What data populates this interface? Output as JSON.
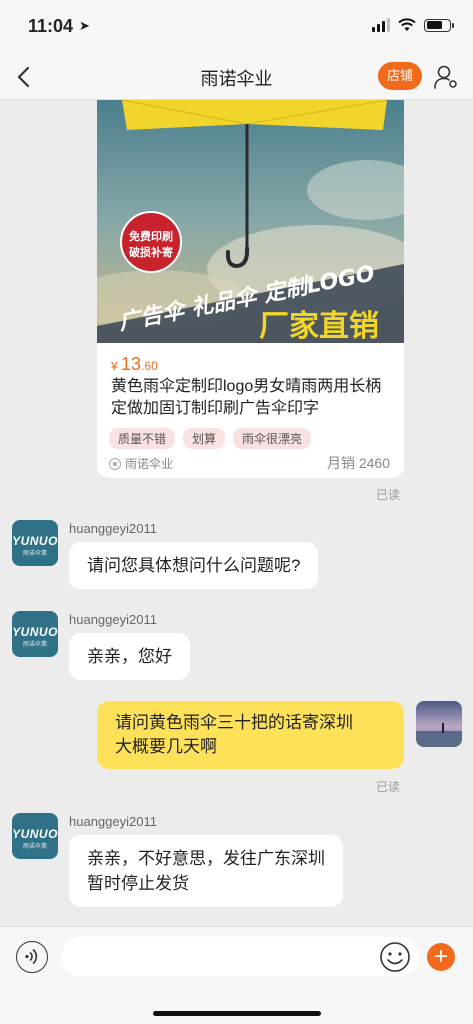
{
  "status_bar": {
    "time": "11:04"
  },
  "nav": {
    "title": "雨诺伞业",
    "shop_button": "店铺"
  },
  "product": {
    "image_text": {
      "badge_line1": "免费印刷",
      "badge_line2": "破损补寄",
      "slogan": "广告伞 礼品伞 定制LOGO",
      "headline": "厂家直销"
    },
    "price_symbol": "¥",
    "price_main": "13",
    "price_decimal": ".60",
    "title": "黄色雨伞定制印logo男女晴雨两用长柄定做加固订制印刷广告伞印字",
    "tags": [
      "质量不错",
      "划算",
      "雨伞很漂亮"
    ],
    "shop_name": "雨诺伞业",
    "sales": "月销 2460"
  },
  "messages": [
    {
      "from": "shop",
      "sender": "huanggeyi2011",
      "text": "请问您具体想问什么问题呢?"
    },
    {
      "from": "shop",
      "sender": "huanggeyi2011",
      "text": "亲亲，您好"
    },
    {
      "from": "me",
      "line1": "请问黄色雨伞三十把的话寄深圳",
      "line2": "大概要几天啊"
    },
    {
      "from": "shop",
      "sender": "huanggeyi2011",
      "line1": "亲亲，不好意思，发往广东深圳",
      "line2": "暂时停止发货"
    }
  ],
  "read_label": "已读",
  "shop_avatar": {
    "logo_text": "YUNUO",
    "sub_text": "雨诺伞業"
  },
  "input": {
    "placeholder": ""
  },
  "colors": {
    "accent": "#f26b1d",
    "my_bubble": "#fde159"
  }
}
